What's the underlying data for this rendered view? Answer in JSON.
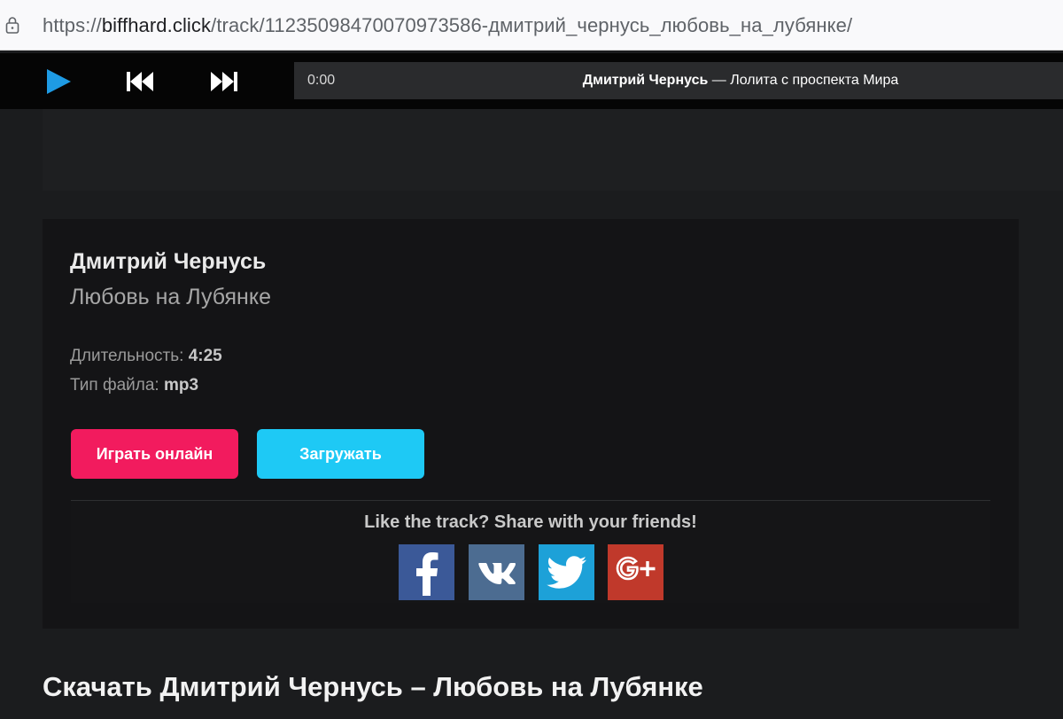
{
  "browser": {
    "url_prefix": "https://",
    "url_domain": "biffhard.click",
    "url_path": "/track/11235098470070973586-дмитрий_чернусь_любовь_на_лубянке/"
  },
  "player": {
    "time": "0:00",
    "now_playing_artist": "Дмитрий Чернусь",
    "now_playing_rest": " — Лолита с проспекта Мира",
    "icons": {
      "play": "play-icon",
      "prev": "previous-track-icon",
      "next": "next-track-icon"
    }
  },
  "track": {
    "artist": "Дмитрий Чернусь",
    "title": "Любовь на Лубянке",
    "duration_label": "Длительность: ",
    "duration": "4:25",
    "filetype_label": "Тип файла: ",
    "filetype": "mp3"
  },
  "buttons": {
    "play_online": "Играть онлайн",
    "download": "Загружать"
  },
  "share": {
    "caption": "Like the track? Share with your friends!",
    "networks": [
      "facebook-icon",
      "vk-icon",
      "twitter-icon",
      "google-plus-icon"
    ]
  },
  "heading": "Скачать Дмитрий Чернусь – Любовь на Лубянке",
  "colors": {
    "play_online": "#f21b5e",
    "download": "#1ec9f5",
    "play_icon": "#1e9be4",
    "facebook": "#3b5998",
    "vk": "#4c6c91",
    "twitter": "#1da1d8",
    "google_plus": "#c0392b"
  }
}
